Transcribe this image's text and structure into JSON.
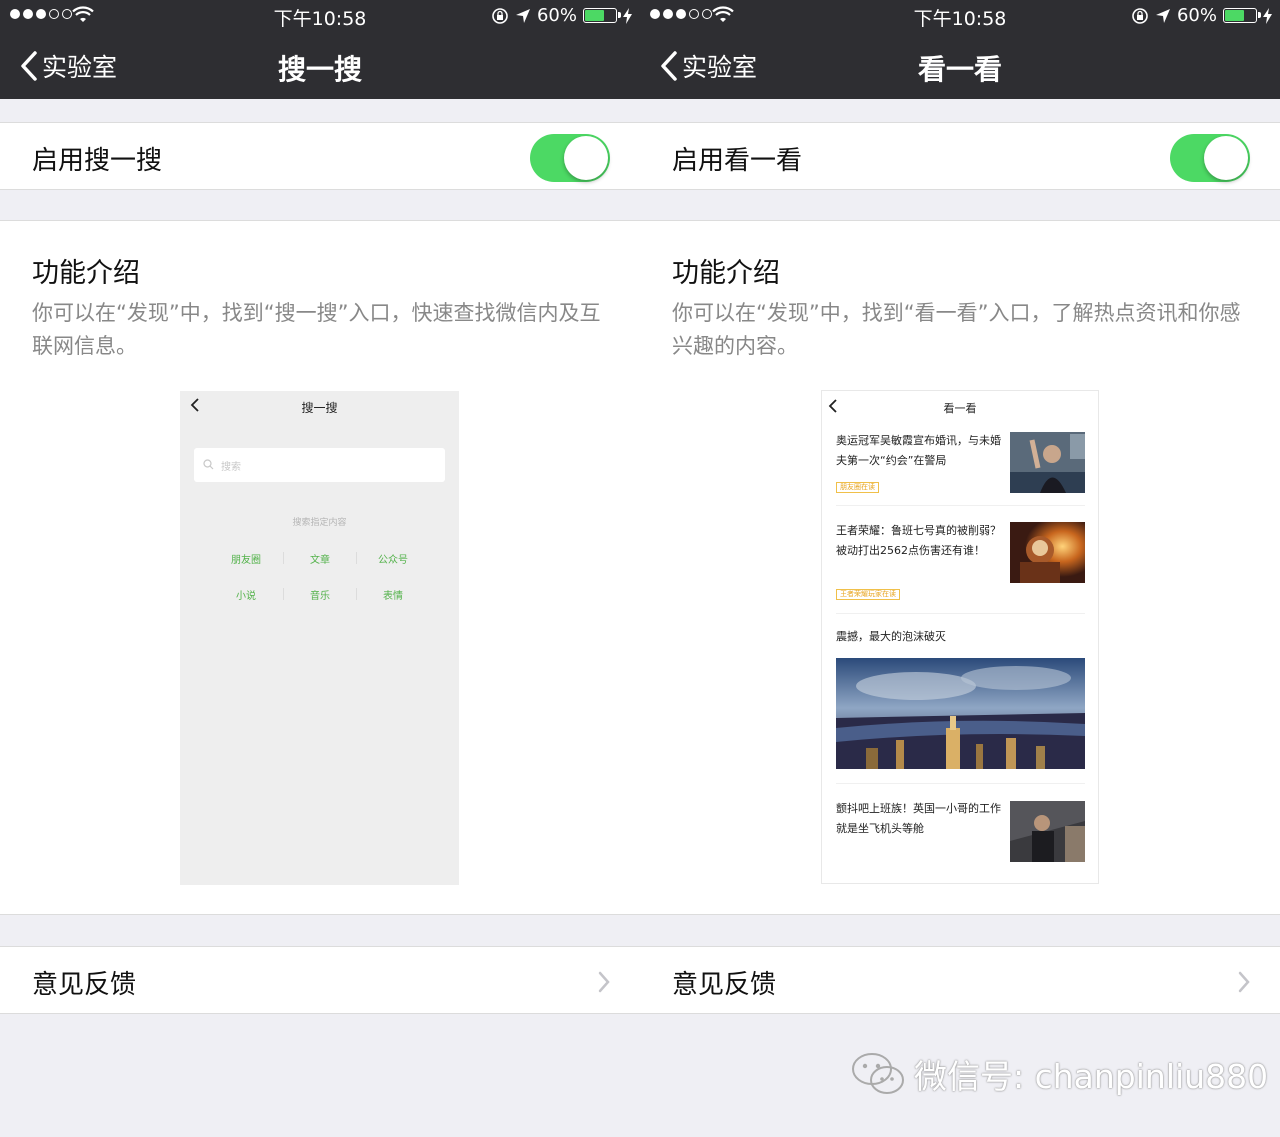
{
  "status_bar": {
    "time": "下午10:58",
    "battery": "60%",
    "battery_level": 0.6
  },
  "back_label": "实验室",
  "left": {
    "title": "搜一搜",
    "toggle_label": "启用搜一搜",
    "toggle_on": true,
    "intro_heading": "功能介绍",
    "intro_text": "你可以在“发现”中，找到“搜一搜”入口，快速查找微信内及互联网信息。",
    "feedback_label": "意见反馈",
    "mock": {
      "title": "搜一搜",
      "search_placeholder": "搜索",
      "hint": "搜索指定内容",
      "categories": [
        "朋友圈",
        "文章",
        "公众号",
        "小说",
        "音乐",
        "表情"
      ]
    }
  },
  "right": {
    "title": "看一看",
    "toggle_label": "启用看一看",
    "toggle_on": true,
    "intro_heading": "功能介绍",
    "intro_text": "你可以在“发现”中，找到“看一看”入口，了解热点资讯和你感兴趣的内容。",
    "feedback_label": "意见反馈",
    "mock": {
      "title": "看一看",
      "news": [
        {
          "text": "奥运冠军吴敏霞宣布婚讯，与未婚夫第一次“约会”在警局",
          "tag": "朋友圈在读"
        },
        {
          "text": "王者荣耀：鲁班七号真的被削弱？被动打出2562点伤害还有谁！",
          "tag": "王者荣耀玩家在读"
        },
        {
          "text": "震撼，最大的泡沫破灭",
          "tag": ""
        },
        {
          "text": "颤抖吧上班族！英国一小哥的工作就是坐飞机头等舱",
          "tag": ""
        }
      ]
    }
  },
  "watermark": "微信号: chanpinliu880",
  "colors": {
    "bar": "#2e2e32",
    "toggle_on": "#4cd964",
    "mock_green": "#53b24a",
    "background": "#efeff4"
  }
}
